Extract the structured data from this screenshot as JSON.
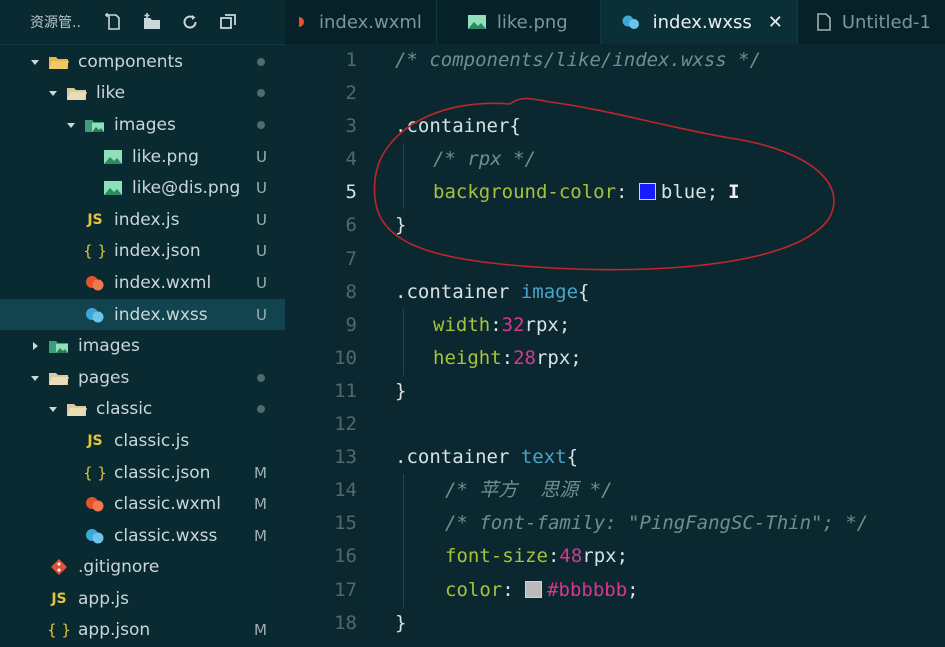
{
  "sidebar": {
    "title": "资源管..",
    "toolbar_icons": [
      "new-file-icon",
      "new-folder-icon",
      "refresh-icon",
      "collapse-icon"
    ],
    "tree": [
      {
        "label": "components",
        "indent": 0,
        "arrow": "down",
        "icon": "folder-open-icon",
        "status": "dot"
      },
      {
        "label": "like",
        "indent": 1,
        "arrow": "down",
        "icon": "folder-open-icon",
        "status": "dot"
      },
      {
        "label": "images",
        "indent": 2,
        "arrow": "down",
        "icon": "image-folder-icon",
        "status": "dot"
      },
      {
        "label": "like.png",
        "indent": 3,
        "arrow": "",
        "icon": "image-file-icon",
        "status": "U"
      },
      {
        "label": "like@dis.png",
        "indent": 3,
        "arrow": "",
        "icon": "image-file-icon",
        "status": "U"
      },
      {
        "label": "index.js",
        "indent": 2,
        "arrow": "",
        "icon": "js-file-icon",
        "status": "U"
      },
      {
        "label": "index.json",
        "indent": 2,
        "arrow": "",
        "icon": "json-file-icon",
        "status": "U"
      },
      {
        "label": "index.wxml",
        "indent": 2,
        "arrow": "",
        "icon": "wxml-file-icon",
        "status": "U"
      },
      {
        "label": "index.wxss",
        "indent": 2,
        "arrow": "",
        "icon": "wxss-file-icon",
        "status": "U",
        "selected": true
      },
      {
        "label": "images",
        "indent": 0,
        "arrow": "right",
        "icon": "image-folder-icon",
        "status": ""
      },
      {
        "label": "pages",
        "indent": 0,
        "arrow": "down",
        "icon": "folder-open-icon",
        "status": "dot"
      },
      {
        "label": "classic",
        "indent": 1,
        "arrow": "down",
        "icon": "folder-open-icon",
        "status": "dot"
      },
      {
        "label": "classic.js",
        "indent": 2,
        "arrow": "",
        "icon": "js-file-icon",
        "status": ""
      },
      {
        "label": "classic.json",
        "indent": 2,
        "arrow": "",
        "icon": "json-file-icon",
        "status": "M"
      },
      {
        "label": "classic.wxml",
        "indent": 2,
        "arrow": "",
        "icon": "wxml-file-icon",
        "status": "M"
      },
      {
        "label": "classic.wxss",
        "indent": 2,
        "arrow": "",
        "icon": "wxss-file-icon",
        "status": "M"
      },
      {
        "label": ".gitignore",
        "indent": 0,
        "arrow": "",
        "icon": "git-file-icon",
        "status": ""
      },
      {
        "label": "app.js",
        "indent": 0,
        "arrow": "",
        "icon": "js-file-icon",
        "status": ""
      },
      {
        "label": "app.json",
        "indent": 0,
        "arrow": "",
        "icon": "json-file-icon",
        "status": "M"
      }
    ]
  },
  "tabs": [
    {
      "label": "index.wxml",
      "icon": "wxml-file-icon",
      "active": false
    },
    {
      "label": "like.png",
      "icon": "image-file-icon",
      "active": false
    },
    {
      "label": "index.wxss",
      "icon": "wxss-file-icon",
      "active": true,
      "close": "✕"
    },
    {
      "label": "Untitled-1",
      "icon": "untitled-file-icon",
      "active": false
    }
  ],
  "editor": {
    "current_line": 5,
    "lines": [
      {
        "n": "1",
        "text": "/* components/like/index.wxss */"
      },
      {
        "n": "2",
        "text": ""
      },
      {
        "n": "3",
        "text": ".container{"
      },
      {
        "n": "4",
        "text": "/* rpx */"
      },
      {
        "n": "5",
        "text": "background-color: blue;"
      },
      {
        "n": "6",
        "text": "}"
      },
      {
        "n": "7",
        "text": ""
      },
      {
        "n": "8",
        "text": ".container image{"
      },
      {
        "n": "9",
        "text": "width:32rpx;"
      },
      {
        "n": "10",
        "text": "height:28rpx;"
      },
      {
        "n": "11",
        "text": "}"
      },
      {
        "n": "12",
        "text": ""
      },
      {
        "n": "13",
        "text": ".container text{"
      },
      {
        "n": "14",
        "text": "/* 苹方  思源 */"
      },
      {
        "n": "15",
        "text": "/* font-family: \"PingFangSC-Thin\"; */"
      },
      {
        "n": "16",
        "text": "font-size:48rpx;"
      },
      {
        "n": "17",
        "text": "color: #bbbbbb;"
      },
      {
        "n": "18",
        "text": "}"
      }
    ],
    "tokens": {
      "l1": "/* components/like/index.wxss */",
      "l3_sel": ".container",
      "l3_brace": "{",
      "l4": "/* rpx */",
      "l5_prop": "background-color",
      "l5_colon": ": ",
      "l5_val": "blue",
      "l5_semi": ";",
      "l6": "}",
      "l8_sel": ".container ",
      "l8_tag": "image",
      "l8_brace": "{",
      "l9_prop": "width",
      "l9_colon": ":",
      "l9_num": "32",
      "l9_unit": "rpx;",
      "l10_prop": "height",
      "l10_colon": ":",
      "l10_num": "28",
      "l10_unit": "rpx;",
      "l11": "}",
      "l13_sel": ".container ",
      "l13_tag": "text",
      "l13_brace": "{",
      "l14": "/* 苹方  思源 */",
      "l15": "/* font-family: \"PingFangSC-Thin\"; */",
      "l16_prop": "font-size",
      "l16_colon": ":",
      "l16_num": "48",
      "l16_unit": "rpx;",
      "l17_prop": "color",
      "l17_colon": ": ",
      "l17_val": "#bbbbbb",
      "l17_semi": ";",
      "l18": "}"
    },
    "swatch_colors": {
      "blue": "#1a1aff",
      "bbbbbb": "#bbbbbb"
    },
    "annotation_color": "#c0262b"
  },
  "colors": {
    "background": "#0b2830",
    "sidebar": "#0a2a31",
    "selected_row": "#12444f",
    "comment": "#6e8e93",
    "property": "#a5c33a",
    "tag": "#4aa4c9",
    "number": "#d3398d"
  }
}
